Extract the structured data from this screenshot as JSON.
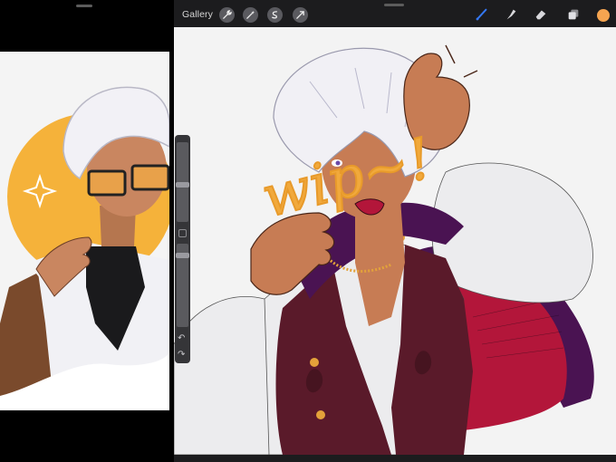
{
  "toolbar": {
    "gallery_label": "Gallery",
    "actions": [
      {
        "name": "wrench-icon"
      },
      {
        "name": "magic-wand-icon"
      },
      {
        "name": "selection-icon"
      },
      {
        "name": "transform-icon"
      }
    ],
    "right_tools": [
      {
        "name": "brush-icon",
        "active": true
      },
      {
        "name": "smudge-icon",
        "active": false
      },
      {
        "name": "eraser-icon",
        "active": false
      },
      {
        "name": "layers-icon",
        "active": false
      }
    ],
    "current_color": "#f5a450"
  },
  "canvas": {
    "overlay_text": "wip~!",
    "overlay_color": "#f1a93c"
  },
  "colors": {
    "accent_brush": "#3478f6",
    "vest": "#5a1a2a",
    "cape_inner": "#b3163a",
    "cape_outer": "#4a1352",
    "skin": "#c77c54",
    "hair": "#f1f0f5",
    "left_background": "#f5b23a"
  }
}
